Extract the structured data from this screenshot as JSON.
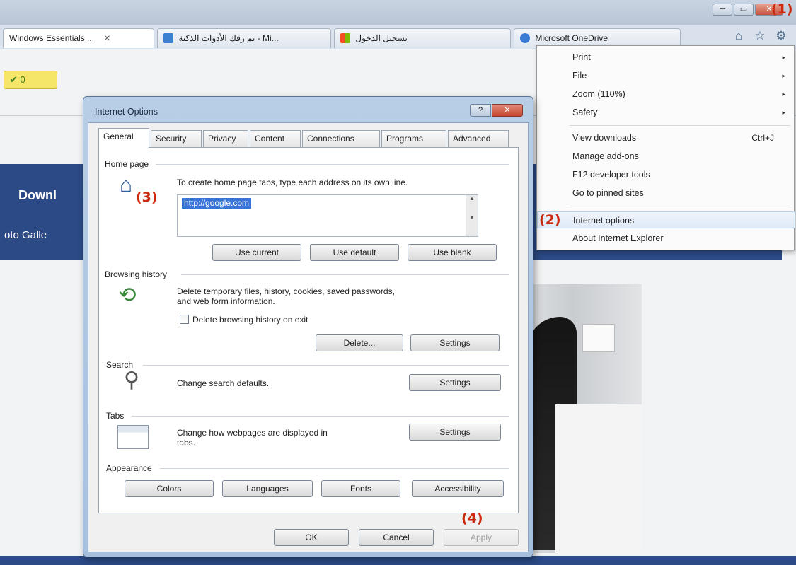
{
  "browser": {
    "window_controls": [
      "─",
      "▭",
      "✕"
    ],
    "tabs": [
      {
        "label": "Windows Essentials ...",
        "close": "✕",
        "favicon_color": "#ffffff"
      },
      {
        "label": "تم رفك الأدوات الذكية - Mi...",
        "favicon_color": "#3d7fd1"
      },
      {
        "label": "تسجيل الدخول",
        "favicon_color": "#f25022"
      },
      {
        "label": "Microsoft OneDrive",
        "favicon_color": "#3a7bd5"
      }
    ],
    "toolbar_icons": [
      "home-icon",
      "star-icon",
      "gear-icon"
    ]
  },
  "page": {
    "badge": "✔ 0",
    "banner_title": "Downl",
    "banner_subtitle": "oto Galle"
  },
  "menu": {
    "items": [
      {
        "label": "Print",
        "arrow": "▸"
      },
      {
        "label": "File",
        "arrow": "▸"
      },
      {
        "label": "Zoom (110%)",
        "arrow": "▸"
      },
      {
        "label": "Safety",
        "arrow": "▸"
      },
      {
        "label": "View downloads",
        "shortcut": "Ctrl+J"
      },
      {
        "label": "Manage add-ons"
      },
      {
        "label": "F12 developer tools"
      },
      {
        "label": "Go to pinned sites"
      },
      {
        "label": "Internet options"
      },
      {
        "label": "About Internet Explorer"
      }
    ]
  },
  "dialog": {
    "title": "Internet Options",
    "help": "?",
    "close": "✕",
    "tabs": [
      "General",
      "Security",
      "Privacy",
      "Content",
      "Connections",
      "Programs",
      "Advanced"
    ],
    "home_page": {
      "label": "Home page",
      "instruction": "To create home page tabs, type each address on its own line.",
      "value": "http://google.com",
      "use_current": "Use current",
      "use_default": "Use default",
      "use_blank": "Use blank"
    },
    "browsing_history": {
      "label": "Browsing history",
      "description_line1": "Delete temporary files, history, cookies, saved passwords,",
      "description_line2": "and web form information.",
      "checkbox_label": "Delete browsing history on exit",
      "delete": "Delete...",
      "settings": "Settings"
    },
    "search": {
      "label": "Search",
      "description": "Change search defaults.",
      "settings": "Settings"
    },
    "tabs_section": {
      "label": "Tabs",
      "description_line1": "Change how webpages are displayed in",
      "description_line2": "tabs.",
      "settings": "Settings"
    },
    "appearance": {
      "label": "Appearance",
      "colors": "Colors",
      "languages": "Languages",
      "fonts": "Fonts",
      "accessibility": "Accessibility"
    },
    "ok": "OK",
    "cancel": "Cancel",
    "apply": "Apply"
  },
  "callouts": [
    "(1)",
    "(2)",
    "(3)",
    "(4)"
  ],
  "colors": {
    "callout": "#cc2a10",
    "selection": "#3875d7",
    "banner": "#2b4a86"
  }
}
